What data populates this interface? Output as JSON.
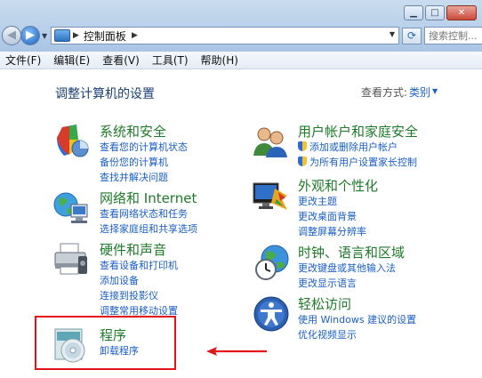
{
  "window": {
    "buttons": {
      "minimize": "▁",
      "maximize": "□",
      "close": "✕"
    }
  },
  "nav": {
    "back": "◀",
    "forward": "▶",
    "address": "控制面板",
    "search_placeholder": "搜索控制..."
  },
  "menu": [
    "文件(F)",
    "编辑(E)",
    "查看(V)",
    "工具(T)",
    "帮助(H)"
  ],
  "content": {
    "title": "调整计算机的设置",
    "view_by_label": "查看方式:",
    "view_by_value": "类别"
  },
  "categories": {
    "security": {
      "title": "系统和安全",
      "icon": "shield-icon",
      "links": [
        "查看您的计算机状态",
        "备份您的计算机",
        "查找并解决问题"
      ]
    },
    "network": {
      "title": "网络和 Internet",
      "icon": "network-globe-icon",
      "links": [
        "查看网络状态和任务",
        "选择家庭组和共享选项"
      ]
    },
    "hardware": {
      "title": "硬件和声音",
      "icon": "printer-icon",
      "links": [
        "查看设备和打印机",
        "添加设备",
        "连接到投影仪",
        "调整常用移动设置"
      ]
    },
    "programs": {
      "title": "程序",
      "icon": "programs-disc-icon",
      "links": [
        "卸载程序"
      ]
    },
    "users": {
      "title": "用户帐户和家庭安全",
      "icon": "users-icon",
      "links": [
        "添加或删除用户帐户",
        "为所有用户设置家长控制"
      ]
    },
    "appearance": {
      "title": "外观和个性化",
      "icon": "appearance-icon",
      "links": [
        "更改主题",
        "更改桌面背景",
        "调整屏幕分辨率"
      ]
    },
    "clock": {
      "title": "时钟、语言和区域",
      "icon": "clock-globe-icon",
      "links": [
        "更改键盘或其他输入法",
        "更改显示语言"
      ]
    },
    "access": {
      "title": "轻松访问",
      "icon": "accessibility-icon",
      "links": [
        "使用 Windows 建议的设置",
        "优化视频显示"
      ]
    }
  },
  "colors": {
    "category_title": "#1f7a2a",
    "link": "#1a5ec4",
    "highlight": "#e2141a"
  }
}
